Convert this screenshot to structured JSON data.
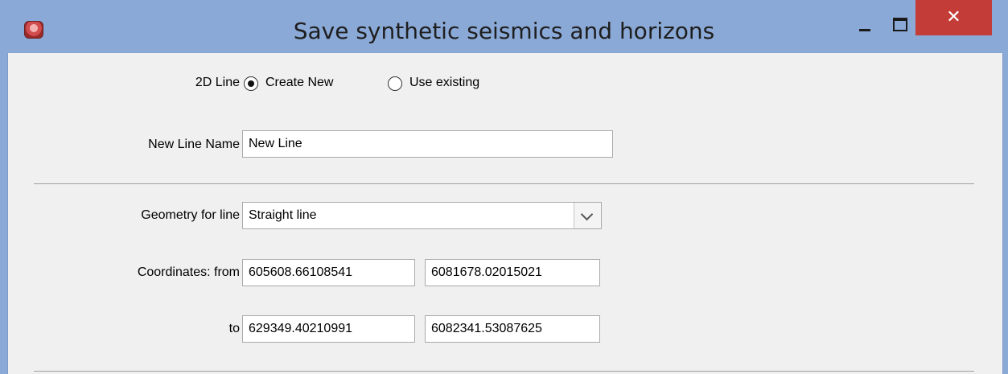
{
  "window": {
    "title": "Save synthetic seismics and horizons"
  },
  "form": {
    "line_label": "2D Line",
    "line_options": [
      {
        "label": "Create New",
        "selected": true
      },
      {
        "label": "Use existing",
        "selected": false
      }
    ],
    "new_line_name_label": "New Line Name",
    "new_line_name_value": "New Line",
    "geometry_label": "Geometry for line",
    "geometry_value": "Straight line",
    "coordinates_from_label": "Coordinates: from",
    "from_x": "605608.66108541",
    "from_y": "6081678.02015021",
    "to_label": "to",
    "to_x": "629349.40210991",
    "to_y": "6082341.53087625"
  }
}
